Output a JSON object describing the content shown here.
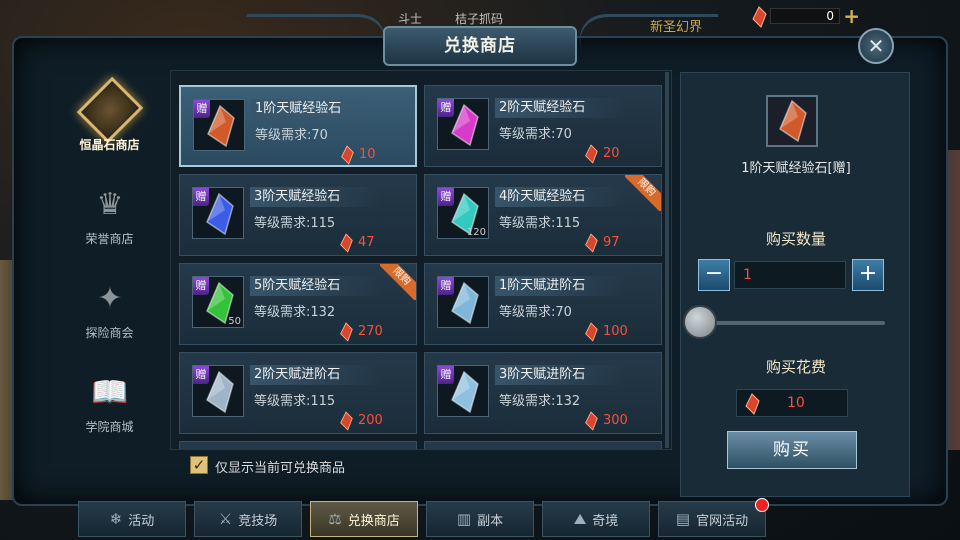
{
  "hud": {
    "left_text": "斗士",
    "center_text": "桔子抓码",
    "right_text": "新圣幻界",
    "currency_value": "0",
    "currency_plus": "+"
  },
  "title": "兑换商店",
  "sidebar": [
    {
      "label": "恒晶石商店",
      "icon": "crystal-shop-icon",
      "active": true
    },
    {
      "label": "荣誉商店",
      "icon": "trophy-icon",
      "active": false
    },
    {
      "label": "探险商会",
      "icon": "adventure-icon",
      "active": false
    },
    {
      "label": "学院商城",
      "icon": "academy-book-icon",
      "active": false
    }
  ],
  "items": [
    {
      "gift": "赠",
      "name": "1阶天赋经验石",
      "req": "等级需求:70",
      "price": "10",
      "color": "#d05a2a",
      "stack": "",
      "limit": "",
      "selected": true
    },
    {
      "gift": "赠",
      "name": "2阶天赋经验石",
      "req": "等级需求:70",
      "price": "20",
      "color": "#d63cc7",
      "stack": "",
      "limit": "",
      "selected": false
    },
    {
      "gift": "赠",
      "name": "3阶天赋经验石",
      "req": "等级需求:115",
      "price": "47",
      "color": "#3a5ce6",
      "stack": "",
      "limit": "",
      "selected": false
    },
    {
      "gift": "赠",
      "name": "4阶天赋经验石",
      "req": "等级需求:115",
      "price": "97",
      "color": "#33c9c0",
      "stack": "120",
      "limit": "限购",
      "selected": false
    },
    {
      "gift": "赠",
      "name": "5阶天赋经验石",
      "req": "等级需求:132",
      "price": "270",
      "color": "#35c23a",
      "stack": "50",
      "limit": "限购",
      "selected": false
    },
    {
      "gift": "赠",
      "name": "1阶天赋进阶石",
      "req": "等级需求:70",
      "price": "100",
      "color": "#7fb6dc",
      "stack": "",
      "limit": "",
      "selected": false
    },
    {
      "gift": "赠",
      "name": "2阶天赋进阶石",
      "req": "等级需求:115",
      "price": "200",
      "color": "#9fb4c6",
      "stack": "",
      "limit": "",
      "selected": false
    },
    {
      "gift": "赠",
      "name": "3阶天赋进阶石",
      "req": "等级需求:132",
      "price": "300",
      "color": "#8fc0e0",
      "stack": "",
      "limit": "",
      "selected": false
    }
  ],
  "filter_label": "仅显示当前可兑换商品",
  "filter_checked": "✓",
  "panel": {
    "selected_name": "1阶天赋经验石[赠]",
    "qty_label": "购买数量",
    "qty_minus": "−",
    "qty_plus": "+",
    "qty_value": "1",
    "qty_fraction": 0,
    "cost_label": "购买花费",
    "cost_value": "10",
    "buy_label": "购买"
  },
  "tabs": [
    {
      "label": "活动",
      "icon": "snowflake-icon",
      "active": false,
      "badge": false
    },
    {
      "label": "竞技场",
      "icon": "crossed-swords-icon",
      "active": false,
      "badge": false
    },
    {
      "label": "兑换商店",
      "icon": "scales-icon",
      "active": true,
      "badge": false
    },
    {
      "label": "副本",
      "icon": "dungeon-gate-icon",
      "active": false,
      "badge": false
    },
    {
      "label": "奇境",
      "icon": "mountain-icon",
      "active": false,
      "badge": false
    },
    {
      "label": "官网活动",
      "icon": "book-icon",
      "active": false,
      "badge": true
    }
  ]
}
